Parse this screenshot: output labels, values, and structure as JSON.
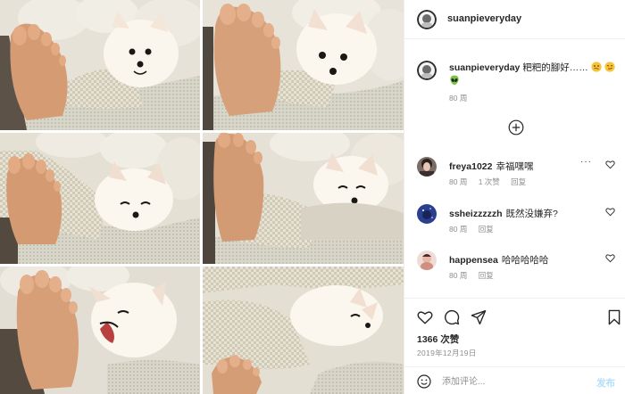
{
  "post": {
    "username": "suanpieveryday"
  },
  "caption": {
    "username": "suanpieveryday",
    "text": "粑粑的腳好……",
    "time": "80 周"
  },
  "comments": [
    {
      "username": "freya1022",
      "text": "幸福嘿嘿",
      "time": "80 周",
      "likes": "1 次赞",
      "reply": "回复",
      "more": "···"
    },
    {
      "username": "ssheizzzzzh",
      "text": "既然没嫌弃?",
      "time": "80 周",
      "reply": "回复"
    },
    {
      "username": "happensea",
      "text": "哈哈哈哈哈",
      "time": "80 周",
      "reply": "回复"
    }
  ],
  "stats": {
    "likes": "1366 次赞",
    "date": "2019年12月19日"
  },
  "composer": {
    "placeholder": "添加评论...",
    "post_label": "发布"
  },
  "icons": {
    "header_avatar": "avatar",
    "load_more": "plus-circle-icon",
    "like": "heart-icon",
    "comment": "comment-icon",
    "share": "paper-plane-icon",
    "save": "bookmark-icon",
    "emoji": "smiley-icon"
  },
  "colors": {
    "link_disabled": "#b2dffc",
    "muted_text": "#8e8e8e",
    "border": "#efefef"
  }
}
